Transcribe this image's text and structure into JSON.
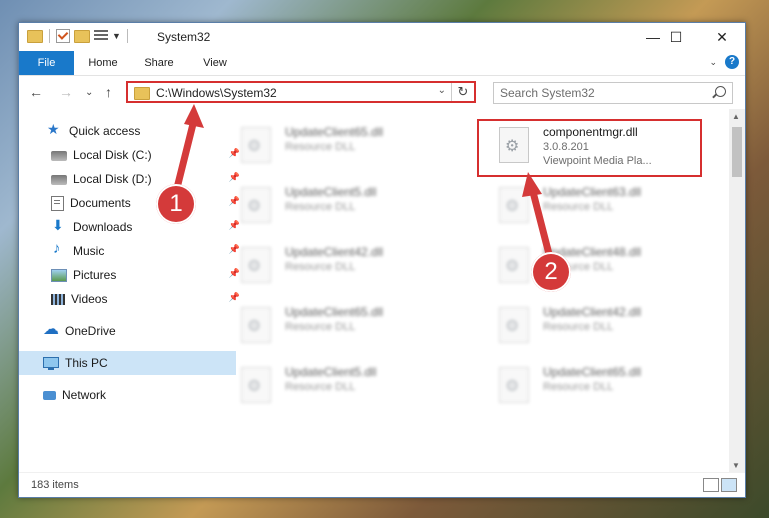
{
  "window": {
    "title": "System32",
    "controls": {
      "minimize": "—",
      "maximize": "☐",
      "close": "✕"
    }
  },
  "ribbon": {
    "tabs": [
      {
        "label": "File",
        "active": true
      },
      {
        "label": "Home"
      },
      {
        "label": "Share"
      },
      {
        "label": "View"
      }
    ],
    "collapse": "⌄",
    "help": "?"
  },
  "nav": {
    "back": "←",
    "forward": "→",
    "recent": "⌄",
    "up": "↑",
    "address": "C:\\Windows\\System32",
    "address_dropdown": "⌄",
    "refresh": "↻",
    "search_placeholder": "Search System32"
  },
  "sidebar": {
    "items": [
      {
        "label": "Quick access",
        "icon": "star-icon",
        "pinned": false
      },
      {
        "label": "Local Disk (C:)",
        "icon": "disk-icon",
        "pinned": true
      },
      {
        "label": "Local Disk (D:)",
        "icon": "disk-icon",
        "pinned": true
      },
      {
        "label": "Documents",
        "icon": "documents-icon",
        "pinned": true
      },
      {
        "label": "Downloads",
        "icon": "downloads-icon",
        "pinned": true
      },
      {
        "label": "Music",
        "icon": "music-icon",
        "pinned": true
      },
      {
        "label": "Pictures",
        "icon": "pictures-icon",
        "pinned": true
      },
      {
        "label": "Videos",
        "icon": "videos-icon",
        "pinned": true
      },
      {
        "label": "OneDrive",
        "icon": "onedrive-icon",
        "pinned": false
      },
      {
        "label": "This PC",
        "icon": "this-pc-icon",
        "pinned": false,
        "selected": true
      },
      {
        "label": "Network",
        "icon": "network-icon",
        "pinned": false
      }
    ],
    "pin_glyph": "📌"
  },
  "files": {
    "left_column": [
      {
        "name": "UpdateClient65.dll",
        "type": "Resource DLL"
      },
      {
        "name": "UpdateClient5.dll",
        "type": "Resource DLL"
      },
      {
        "name": "UpdateClient42.dll",
        "type": "Resource DLL"
      },
      {
        "name": "UpdateClient65.dll",
        "type": "Resource DLL"
      },
      {
        "name": "UpdateClient5.dll",
        "type": "Resource DLL"
      }
    ],
    "right_column": [
      {
        "name": "componentmgr.dll",
        "version": "3.0.8.201",
        "description": "Viewpoint Media Pla..."
      },
      {
        "name": "UpdateClient63.dll",
        "type": "Resource DLL"
      },
      {
        "name": "UpdateClient48.dll",
        "type": "Resource DLL"
      },
      {
        "name": "UpdateClient42.dll",
        "type": "Resource DLL"
      },
      {
        "name": "UpdateClient65.dll",
        "type": "Resource DLL"
      }
    ]
  },
  "status": {
    "item_count": "183 items"
  },
  "annotations": {
    "badge_1": "1",
    "badge_2": "2"
  },
  "colors": {
    "accent": "#1979ca",
    "annotation": "#d43a3a",
    "selection": "#cce4f7"
  }
}
